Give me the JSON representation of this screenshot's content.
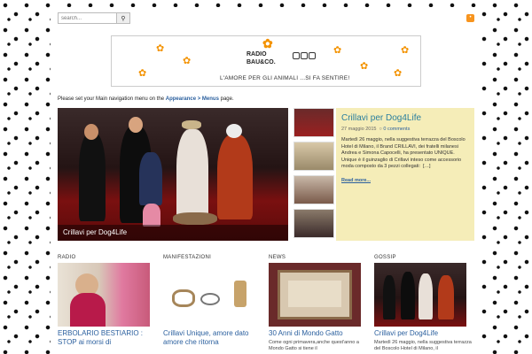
{
  "header": {
    "search_placeholder": "search...",
    "search_icon": "magnifier-icon",
    "rss_icon": "rss-icon"
  },
  "banner": {
    "logo_text_line1": "RADIO",
    "logo_text_line2": "BAU&CO.",
    "tagline": "L'AMORE PER GLI ANIMALI ...SI FA SENTIRE!",
    "paw_color": "#f39200"
  },
  "nav_note": {
    "prefix": "Please set your Main navigation menu on the ",
    "link": "Appearance > Menus",
    "suffix": " page."
  },
  "featured": {
    "caption": "Crillavi per Dog4Life"
  },
  "post": {
    "title": "Crillavi per Dog4Life",
    "date": "27 maggio 2015",
    "comments": "0 comments",
    "excerpt": "Martedì 26 maggio, nella suggestiva terrazza del Boscolo Hotel di Milano, il Brand CRILLAVI, dei fratelli milanesi Andrea e Simona Capocelli, ha presentato UNIQUE. Unique è il guinzaglio di Crillavi inteso come accessorio moda composto da 3 pezzi collegati:",
    "ellipsis": "[…]",
    "read_more": "Read more..."
  },
  "categories": [
    {
      "label": "RADIO",
      "title": "ERBOLARIO BESTIARIO : STOP ai morsi di",
      "excerpt": ""
    },
    {
      "label": "MANIFESTAZIONI",
      "title": "Crillavi Unique, amore dato amore che ritorna",
      "excerpt": ""
    },
    {
      "label": "NEWS",
      "title": "30 Anni di Mondo Gatto",
      "excerpt": "Come ogni primavera,anche quest'anno a Mondo Gatto si tiene il"
    },
    {
      "label": "GOSSIP",
      "title": "Crillavi per Dog4Life",
      "excerpt": "Martedì 26 maggio, nella suggestiva terrazza del Boscolo Hotel di Milano, il"
    }
  ],
  "colors": {
    "accent": "#2a5f9e",
    "post_bg": "#f5edb8",
    "post_title": "#2a7f9e"
  }
}
